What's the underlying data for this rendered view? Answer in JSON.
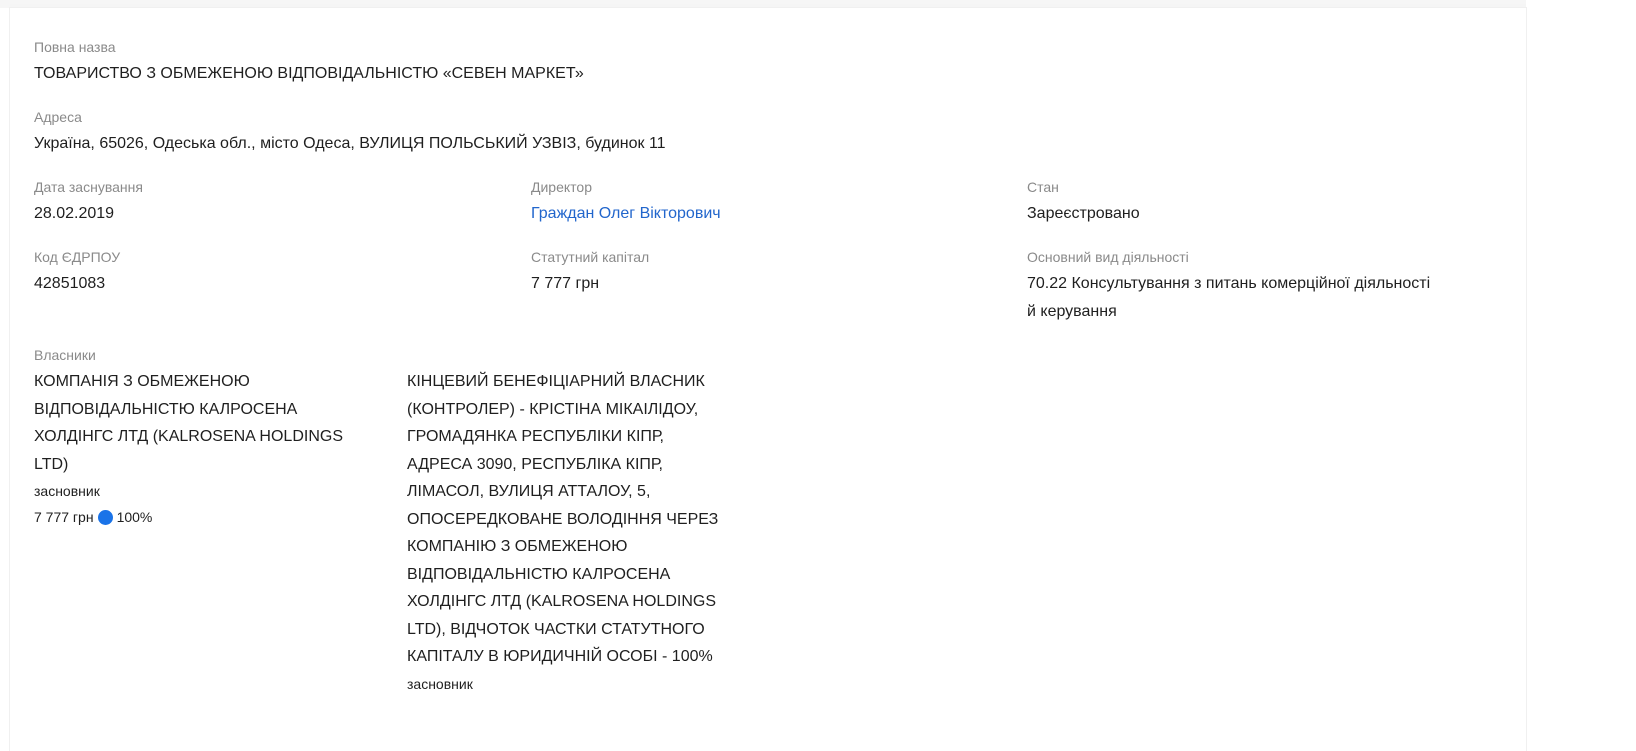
{
  "company": {
    "full_name_label": "Повна назва",
    "full_name": "ТОВАРИСТВО З ОБМЕЖЕНОЮ ВІДПОВІДАЛЬНІСТЮ «СЕВЕН МАРКЕТ»",
    "address_label": "Адреса",
    "address": "Україна, 65026, Одеська обл., місто Одеса, ВУЛИЦЯ ПОЛЬСЬКИЙ УЗВІЗ, будинок 11",
    "founded_label": "Дата заснування",
    "founded": "28.02.2019",
    "director_label": "Директор",
    "director": "Граждан Олег Вікторович",
    "status_label": "Стан",
    "status": "Зареєстровано",
    "edrpou_label": "Код ЄДРПОУ",
    "edrpou": "42851083",
    "capital_label": "Статутний капітал",
    "capital": "7 777 грн",
    "activity_label": "Основний вид діяльності",
    "activity_line1": "70.22 Консультування з питань комерційної діяльності",
    "activity_line2": "й керування"
  },
  "owners": {
    "label": "Власники",
    "items": [
      {
        "name_lines": [
          "КОМПАНІЯ З ОБМЕЖЕНОЮ",
          "ВІДПОВІДАЛЬНІСТЮ КАЛРОСЕНА",
          "ХОЛДІНГС ЛТД (KALROSENA HOLDINGS",
          "LTD)"
        ],
        "role": "засновник",
        "amount": "7 777 грн",
        "share": "100%",
        "share_color": "#1a73e8"
      },
      {
        "name_lines": [
          "КІНЦЕВИЙ БЕНЕФІЦІАРНИЙ ВЛАСНИК",
          "(КОНТРОЛЕР) - КРІСТІНА МІКАІЛІДОУ,",
          "ГРОМАДЯНКА РЕСПУБЛІКИ КІПР,",
          "АДРЕСА 3090, РЕСПУБЛІКА КІПР,",
          "ЛІМАСОЛ, ВУЛИЦЯ АТТАЛОУ, 5,",
          "ОПОСЕРЕДКОВАНЕ ВОЛОДІННЯ ЧЕРЕЗ",
          "КОМПАНІЮ З ОБМЕЖЕНОЮ",
          "ВІДПОВІДАЛЬНІСТЮ КАЛРОСЕНА",
          "ХОЛДІНГС ЛТД (KALROSENA HOLDINGS",
          "LTD), ВІДЧОТОК ЧАСТКИ СТАТУТНОГО",
          "КАПІТАЛУ В ЮРИДИЧНІЙ ОСОБІ - 100%"
        ],
        "role": "засновник"
      }
    ]
  }
}
